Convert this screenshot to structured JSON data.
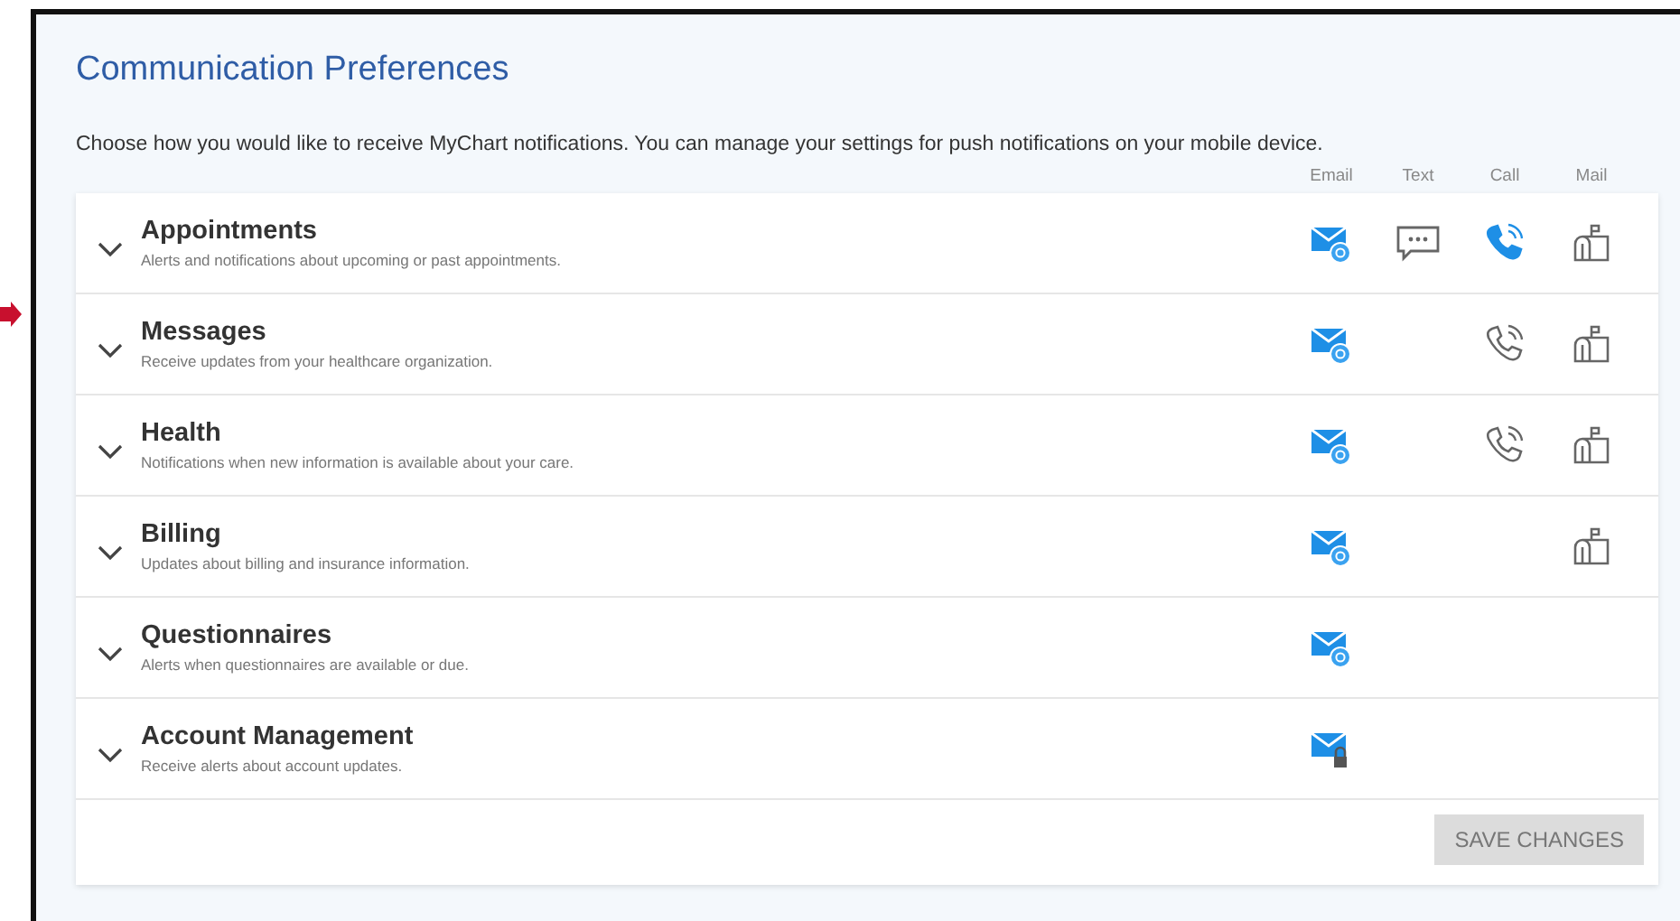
{
  "title": "Communication Preferences",
  "description": "Choose how you would like to receive MyChart notifications. You can manage your settings for push notifications on your mobile device.",
  "columns": [
    {
      "kind": "email",
      "label": "Email"
    },
    {
      "kind": "text",
      "label": "Text"
    },
    {
      "kind": "call",
      "label": "Call"
    },
    {
      "kind": "mail",
      "label": "Mail"
    }
  ],
  "categories": [
    {
      "title": "Appointments",
      "description": "Alerts and notifications about upcoming or past appointments.",
      "expanded": false,
      "channels": [
        {
          "kind": "email",
          "on": true
        },
        {
          "kind": "text",
          "on": false
        },
        {
          "kind": "call",
          "on": true
        },
        {
          "kind": "mail",
          "on": false
        }
      ]
    },
    {
      "title": "Messages",
      "description": "Receive updates from your healthcare organization.",
      "expanded": false,
      "channels": [
        {
          "kind": "email",
          "on": true
        },
        {
          "kind": "call",
          "on": false
        },
        {
          "kind": "mail",
          "on": false
        }
      ]
    },
    {
      "title": "Health",
      "description": "Notifications when new information is available about your care.",
      "expanded": false,
      "channels": [
        {
          "kind": "email",
          "on": true
        },
        {
          "kind": "call",
          "on": false
        },
        {
          "kind": "mail",
          "on": false
        }
      ]
    },
    {
      "title": "Billing",
      "description": "Updates about billing and insurance information.",
      "expanded": false,
      "channels": [
        {
          "kind": "email",
          "on": true
        },
        {
          "kind": "mail",
          "on": false
        }
      ]
    },
    {
      "title": "Questionnaires",
      "description": "Alerts when questionnaires are available or due.",
      "expanded": false,
      "channels": [
        {
          "kind": "email",
          "on": true
        }
      ]
    },
    {
      "title": "Account Management",
      "description": "Receive alerts about account updates.",
      "expanded": false,
      "channels": [
        {
          "kind": "email-secure",
          "on": true
        }
      ]
    }
  ],
  "save_button": {
    "label": "SAVE CHANGES",
    "disabled": true
  }
}
